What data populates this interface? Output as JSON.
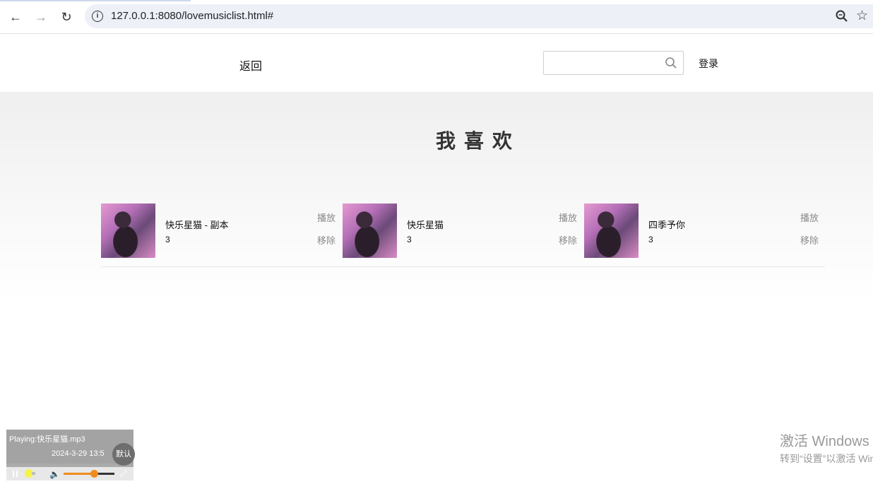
{
  "browser": {
    "url": "127.0.0.1:8080/lovemusiclist.html#",
    "info_icon_glyph": "i",
    "back_glyph": "←",
    "forward_glyph": "→",
    "reload_glyph": "↻",
    "star_glyph": "☆"
  },
  "header": {
    "back_label": "返回",
    "search_placeholder": "",
    "search_value": "",
    "login_label": "登录"
  },
  "main": {
    "title": "我喜欢",
    "songs": [
      {
        "name": "快乐星猫 - 副本",
        "count": "3",
        "play_label": "播放",
        "remove_label": "移除"
      },
      {
        "name": "快乐星猫",
        "count": "3",
        "play_label": "播放",
        "remove_label": "移除"
      },
      {
        "name": "四季予你",
        "count": "3",
        "play_label": "播放",
        "remove_label": "移除"
      }
    ]
  },
  "player": {
    "playing_text": "Playing:快乐星猫.mp3",
    "date_text": "2024-3-29 13:5",
    "mode_label": "默认",
    "volume_glyph": "🔈",
    "expand_glyph": "⤢",
    "volume_fraction": 0.6
  },
  "watermark": {
    "title": "激活 Windows",
    "subtitle": "转到“设置”以激活 Windows。"
  },
  "colors": {
    "accent": "#f08c1e",
    "link_gray": "#8a8a8a",
    "band_top": "#efefef"
  }
}
